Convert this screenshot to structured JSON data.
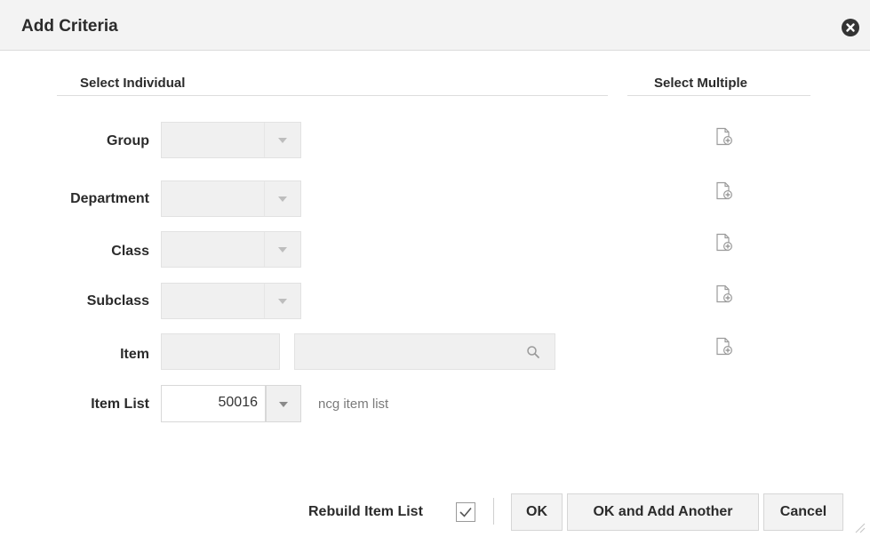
{
  "dialog": {
    "title": "Add Criteria",
    "close_icon": "close-circle-icon"
  },
  "sections": {
    "individual": "Select Individual",
    "multiple": "Select Multiple"
  },
  "fields": {
    "group": {
      "label": "Group",
      "value": ""
    },
    "department": {
      "label": "Department",
      "value": ""
    },
    "class": {
      "label": "Class",
      "value": ""
    },
    "subclass": {
      "label": "Subclass",
      "value": ""
    },
    "item": {
      "label": "Item",
      "value": "",
      "description_value": ""
    },
    "item_list": {
      "label": "Item List",
      "value": "50016",
      "description": "ncg item list"
    }
  },
  "icons": {
    "multi_select": "add-document-icon",
    "search": "search-icon",
    "dropdown": "chevron-down-icon"
  },
  "footer": {
    "rebuild_label": "Rebuild Item List",
    "rebuild_checked": true,
    "ok_label": "OK",
    "ok_add_label": "OK and Add Another",
    "cancel_label": "Cancel"
  }
}
